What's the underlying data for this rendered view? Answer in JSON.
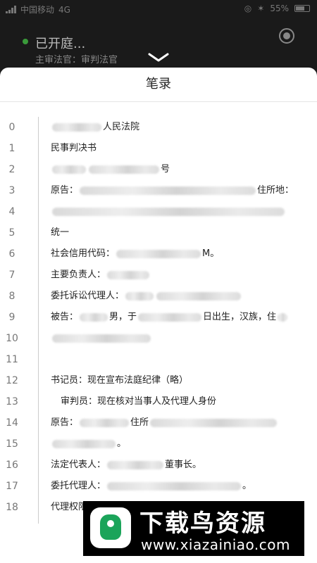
{
  "status_bar": {
    "carrier": "中国移动",
    "network": "4G",
    "battery": "55%"
  },
  "hearing": {
    "status": "已开庭...",
    "judge_label": "主审法官：审判法官"
  },
  "transcript": {
    "title": "笔录",
    "lines": [
      {
        "num": "0",
        "text": "人民法院"
      },
      {
        "num": "1",
        "text": "民事判决书"
      },
      {
        "num": "2",
        "text": "号"
      },
      {
        "num": "3",
        "text": "原告：",
        "text2": "住所地："
      },
      {
        "num": "4",
        "text": ""
      },
      {
        "num": "5",
        "text": "统一"
      },
      {
        "num": "6",
        "text": "社会信用代码：",
        "text2": "M。"
      },
      {
        "num": "7",
        "text": "主要负责人："
      },
      {
        "num": "8",
        "text": "委托诉讼代理人："
      },
      {
        "num": "9",
        "text": "被告：",
        "text2": "男，于",
        "text3": "日出生，汉族，住"
      },
      {
        "num": "10",
        "text": ""
      },
      {
        "num": "11",
        "text": ""
      },
      {
        "num": "12",
        "text": "书记员：现在宣布法庭纪律（略）"
      },
      {
        "num": "13",
        "text": "审判员：现在核对当事人及代理人身份"
      },
      {
        "num": "14",
        "text": "原告：",
        "text2": "住所"
      },
      {
        "num": "15",
        "text": "。"
      },
      {
        "num": "16",
        "text": "法定代表人：",
        "text2": "董事长。"
      },
      {
        "num": "17",
        "text": "委托代理人：",
        "text2": "。"
      },
      {
        "num": "18",
        "text": "代理权限"
      }
    ]
  },
  "watermark": {
    "title": "下载鸟资源",
    "url": "www.xiazainiao.com"
  },
  "colors": {
    "live_dot": "#3a9a3a",
    "sheet_bg": "#ffffff",
    "overlay_bg": "#1a1a1a"
  }
}
